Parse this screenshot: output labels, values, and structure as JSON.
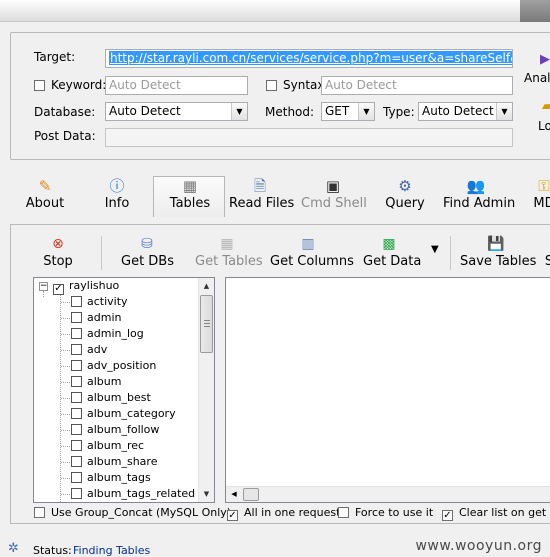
{
  "form": {
    "target_label": "Target:",
    "target_value": "http://star.rayli.com.cn/services/service.php?m=user&a=shareSelf&w",
    "keyword_label": "Keyword:",
    "keyword_placeholder": "Auto Detect",
    "syntax_label": "Syntax:",
    "syntax_placeholder": "Auto Detect",
    "database_label": "Database:",
    "database_value": "Auto Detect",
    "method_label": "Method:",
    "method_value": "GET",
    "type_label": "Type:",
    "type_value": "Auto Detect",
    "postdata_label": "Post Data:"
  },
  "edge": {
    "analyze_label": "Anal",
    "load_label": "Lo"
  },
  "toolbar": [
    {
      "label": "About",
      "icon": "wand-icon"
    },
    {
      "label": "Info",
      "icon": "info-icon"
    },
    {
      "label": "Tables",
      "icon": "tables-icon"
    },
    {
      "label": "Read Files",
      "icon": "file-icon"
    },
    {
      "label": "Cmd Shell",
      "icon": "console-icon"
    },
    {
      "label": "Query",
      "icon": "query-icon"
    },
    {
      "label": "Find Admin",
      "icon": "admin-icon"
    },
    {
      "label": "MD",
      "icon": "key-icon"
    }
  ],
  "actions": {
    "stop": "Stop",
    "get_dbs": "Get DBs",
    "get_tables": "Get Tables",
    "get_columns": "Get Columns",
    "get_data": "Get Data",
    "save_tables": "Save Tables",
    "more": "S"
  },
  "tree": {
    "root": "raylishuo",
    "items": [
      "activity",
      "admin",
      "admin_log",
      "adv",
      "adv_position",
      "album",
      "album_best",
      "album_category",
      "album_follow",
      "album_rec",
      "album_share",
      "album_tags",
      "album_tags_related"
    ]
  },
  "options": {
    "group_concat": "Use Group_Concat (MySQL Only)",
    "all_in_one": "All in one request.",
    "force": "Force to use it",
    "clear_list": "Clear list on get"
  },
  "status": {
    "label": "Status:",
    "value": "Finding Tables"
  },
  "watermark": "www.wooyun.org",
  "colors": {
    "selection": "#3399ff",
    "status_value": "#003399"
  }
}
